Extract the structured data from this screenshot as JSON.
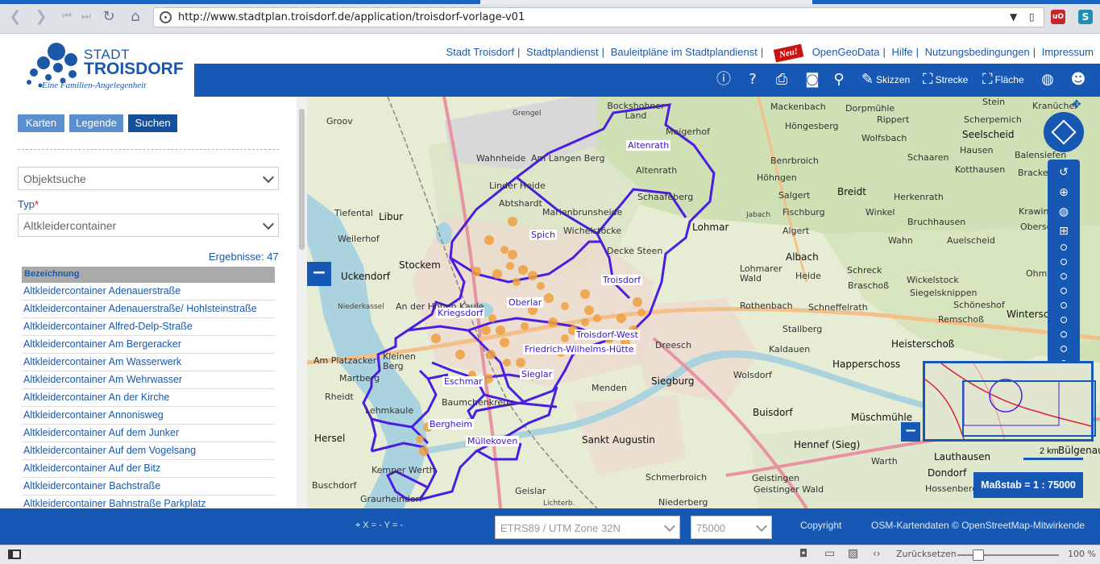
{
  "browser": {
    "url": "http://www.stadtplan.troisdorf.de/application/troisdorf-vorlage-v01",
    "ext1_label": "uO",
    "ext2_label": "S"
  },
  "header": {
    "logo_stadt": "STADT",
    "logo_name": "TROISDORF",
    "logo_tagline": "Eine Familien-Angelegenheit",
    "links": [
      "Stadt Troisdorf",
      "Stadtplandienst",
      "Bauleitpläne im Stadtplandienst",
      "OpenGeoData",
      "Hilfe",
      "Nutzungsbedingungen",
      "Impressum"
    ],
    "new_badge": "Neu!"
  },
  "toolbar": {
    "skizzen": "Skizzen",
    "strecke": "Strecke",
    "flaeche": "Fläche"
  },
  "panel": {
    "tabs": [
      "Karten",
      "Legende",
      "Suchen"
    ],
    "objektsuche": "Objektsuche",
    "typ_label": "Typ",
    "typ_required": "*",
    "typ_value": "Altkleidercontainer",
    "results": "Ergebnisse: 47",
    "column_header": "Bezeichnung",
    "rows": [
      "Altkleidercontainer Adenauerstraße",
      "Altkleidercontainer Adenauerstraße/ Hohlsteinstraße",
      "Altkleidercontainer Alfred-Delp-Straße",
      "Altkleidercontainer Am Bergeracker",
      "Altkleidercontainer Am Wasserwerk",
      "Altkleidercontainer Am Wehrwasser",
      "Altkleidercontainer An der Kirche",
      "Altkleidercontainer Annonisweg",
      "Altkleidercontainer Auf dem Junker",
      "Altkleidercontainer Auf dem Vogelsang",
      "Altkleidercontainer Auf der Bitz",
      "Altkleidercontainer Bachstraße",
      "Altkleidercontainer Bahnstraße Parkplatz"
    ]
  },
  "map": {
    "districts": [
      "Altenrath",
      "Spich",
      "Troisdorf",
      "Oberlar",
      "Kriegsdorf",
      "Troisdorf-West",
      "Friedrich-Wilhelms-Hütte",
      "Sieglar",
      "Eschmar",
      "Bergheim",
      "Müllekoven"
    ],
    "places": [
      {
        "name": "Groov"
      },
      {
        "name": "Bockshohner Land"
      },
      {
        "name": "Mackenbach"
      },
      {
        "name": "Dorpmühle"
      },
      {
        "name": "Rippert"
      },
      {
        "name": "Stein"
      },
      {
        "name": "Kranüchel"
      },
      {
        "name": "Grengel"
      },
      {
        "name": "Meigerhof"
      },
      {
        "name": "Höngesberg"
      },
      {
        "name": "Scherpemich"
      },
      {
        "name": "Seelscheid"
      },
      {
        "name": "Wahnheide"
      },
      {
        "name": "Am Langen Berg"
      },
      {
        "name": "Wolfsbach"
      },
      {
        "name": "Hausen"
      },
      {
        "name": "Balensiefen"
      },
      {
        "name": "Altenrath"
      },
      {
        "name": "Benrbroich"
      },
      {
        "name": "Schaaren"
      },
      {
        "name": "Höhngen"
      },
      {
        "name": "Kotthausen"
      },
      {
        "name": "Bracken"
      },
      {
        "name": "Linder Heide"
      },
      {
        "name": "Abtshardt"
      },
      {
        "name": "Schaafeberg"
      },
      {
        "name": "Salgert"
      },
      {
        "name": "Breidt"
      },
      {
        "name": "Herkenrath"
      },
      {
        "name": "Libur"
      },
      {
        "name": "Tiefental"
      },
      {
        "name": "Marienbrunsheide"
      },
      {
        "name": "Jabach"
      },
      {
        "name": "Fischburg"
      },
      {
        "name": "Winkel"
      },
      {
        "name": "Krawinkel"
      },
      {
        "name": "Weilerhof"
      },
      {
        "name": "Lohmar"
      },
      {
        "name": "Bruchhausen"
      },
      {
        "name": "Wichelstöcke"
      },
      {
        "name": "Algert"
      },
      {
        "name": "Oberscheid"
      },
      {
        "name": "Wahn"
      },
      {
        "name": "Auelscheid"
      },
      {
        "name": "Decke Steen"
      },
      {
        "name": "Albach"
      },
      {
        "name": "Stockem"
      },
      {
        "name": "Schreck"
      },
      {
        "name": "Ohmerath"
      },
      {
        "name": "Uckendorf"
      },
      {
        "name": "Lohmarer Wald"
      },
      {
        "name": "Heide"
      },
      {
        "name": "Wickelstock"
      },
      {
        "name": "Braschoß"
      },
      {
        "name": "Siegelsknippen"
      },
      {
        "name": "Niederkassel"
      },
      {
        "name": "An der Hohen Kaule"
      },
      {
        "name": "Rothenbach"
      },
      {
        "name": "Schneffelrath"
      },
      {
        "name": "Schöneshof"
      },
      {
        "name": "Winterscheid"
      },
      {
        "name": "Remschoß"
      },
      {
        "name": "Stallberg"
      },
      {
        "name": "Heisterschoß"
      },
      {
        "name": "Am Platzacker"
      },
      {
        "name": "Kleinen Berg"
      },
      {
        "name": "Dreesch"
      },
      {
        "name": "Kaldauen"
      },
      {
        "name": "Happerschoss"
      },
      {
        "name": "Martberg"
      },
      {
        "name": "Siegburg"
      },
      {
        "name": "Wolsdorf"
      },
      {
        "name": "Rheidt"
      },
      {
        "name": "Baumchenkreuz"
      },
      {
        "name": "Menden"
      },
      {
        "name": "Lehmkaule"
      },
      {
        "name": "Buisdorf"
      },
      {
        "name": "Müschmühle"
      },
      {
        "name": "Hersel"
      },
      {
        "name": "Sankt Augustin"
      },
      {
        "name": "Hennef (Sieg)"
      },
      {
        "name": "Lauthausen"
      },
      {
        "name": "Warth"
      },
      {
        "name": "Bülgenauel"
      },
      {
        "name": "Kemper Werth"
      },
      {
        "name": "Dondorf"
      },
      {
        "name": "Buschdorf"
      },
      {
        "name": "Geistingen"
      },
      {
        "name": "Geistinger Wald"
      },
      {
        "name": "Hossenberg"
      },
      {
        "name": "Graurheindorf"
      },
      {
        "name": "Geislar"
      },
      {
        "name": "Schmerbroich"
      },
      {
        "name": "Niederberg"
      },
      {
        "name": "Lichterb."
      }
    ],
    "scale": "Maßstab = 1 : 75000",
    "overview_scale": "2 km"
  },
  "footer": {
    "coords": "X = - Y = -",
    "crs": "ETRS89 / UTM Zone 32N",
    "scale_value": "75000",
    "copyright": "Copyright",
    "osm": "OSM-Kartendaten © OpenStreetMap-Mitwirkende"
  },
  "statusbar": {
    "reset": "Zurücksetzen",
    "zoom": "100 %"
  },
  "colors": {
    "brand_blue": "#1658b3",
    "district_border": "#4a1de0",
    "container_marker": "#f0a040"
  }
}
